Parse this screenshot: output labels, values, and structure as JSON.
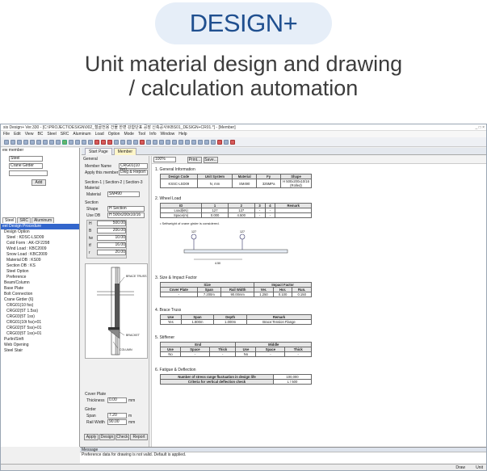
{
  "headline": {
    "badge": "DESIGN+",
    "line1": "Unit material design and drawing",
    "line2": "/ calculation automation"
  },
  "app": {
    "title": "sis Design+ Ver.330 - [C:\\PROJECT\\DESIGN\\002_철골전용 건물 한편 강합단표 공장 신축공사\\KBS01_DESIGN+CR01.*] - [Member]",
    "window_controls": "_ □ ×",
    "menus": [
      "File",
      "Edit",
      "View",
      "BC",
      "Steel",
      "SRC",
      "Aluminum",
      "Load",
      "Option",
      "Mode",
      "Tool",
      "Info",
      "Window",
      "Help"
    ]
  },
  "left": {
    "header": "ew member",
    "material_value": "Steel",
    "type_value": "Crane Girder",
    "add_label": "Add",
    "tabs": [
      "Steel",
      "SRC",
      "Aluminum"
    ],
    "tree": [
      "eel Design Procedure",
      "Design Option",
      "Steel : KDSC-LSD09",
      "Cold Form : AK-CF2298",
      "Wind Load : KBC2009",
      "Snow Load : KBC2009",
      "Material DB : KS09",
      "Section DB : KS",
      "Steel Option",
      "Preference",
      "Beam/Column",
      "Base Plate",
      "Bolt Connection",
      "Crane Girder (6)",
      "CRG01(10 fss)",
      "CRG02(5T 1.5ss)",
      "CRG03(5T 1ss)",
      "CRG01(10t fss)+01",
      "CRG02(5T 5ss)+01",
      "CRG03(5T 1ss)+01",
      "Purlin/Sinft",
      "Web Opening",
      "Steel Stair"
    ]
  },
  "doc_tabs": [
    "Start Page",
    "Member"
  ],
  "form": {
    "general": "General",
    "member_name_label": "Member Name",
    "member_name_value": "CRG01(10 fss)",
    "apply_label": "Apply this member to",
    "apply_value": "Dwg & Report",
    "section_tabs": "Section-1 | Section-2 | Section-3",
    "material_group": "Material",
    "material_label": "Material",
    "material_value": "SM490",
    "section_group": "Section",
    "shape_label": "Shape",
    "shape_value": "H Section",
    "use_db_label": "Use DB",
    "use_db_value": "H 500x200x10/16",
    "dims": [
      {
        "k": "H",
        "v": "500.00"
      },
      {
        "k": "B",
        "v": "200.00"
      },
      {
        "k": "tw",
        "v": "10.00"
      },
      {
        "k": "tf",
        "v": "16.00"
      },
      {
        "k": "r",
        "v": "20.00"
      }
    ],
    "draw_labels": {
      "brace": "BRACE TRUSS",
      "bracket": "BRACKET",
      "column": "COLUMN"
    },
    "cover_plate": "Cover Plate",
    "thickness_label": "Thickness",
    "thickness_value": "0.00",
    "thickness_unit": "mm",
    "girder": "Girder",
    "span_label": "Span",
    "span_value": "7.20",
    "span_unit": "m",
    "rail_label": "Rail Width",
    "rail_value": "90.00",
    "rail_unit": "mm",
    "buttons": [
      "Apply",
      "Design",
      "Check",
      "Report"
    ]
  },
  "report": {
    "zoom": "100%",
    "print": "Print...",
    "save": "Save...",
    "s1": "1. General Information",
    "t1h": [
      "Design Code",
      "Unit System",
      "Material",
      "Fy",
      "Shape"
    ],
    "t1r": [
      "KSSC-LSD09",
      "N, mm",
      "SM490",
      "325MPa",
      "H 500x200x10/16 (Rolled)"
    ],
    "s2": "2. Wheel Load",
    "t2h": [
      "ID",
      "1",
      "2",
      "3",
      "4",
      "Remark"
    ],
    "t2r": [
      [
        "Load(kN)",
        "127",
        "127",
        "-",
        "-",
        ""
      ],
      [
        "Space(m)",
        "0.000",
        "4.500",
        "-",
        "-",
        ""
      ]
    ],
    "note2": "• Selfweight of crane girder is considered.",
    "w1": "127",
    "w2": "127",
    "dim2": "4.50",
    "s3": "3. Size & Impact Factor",
    "t3top": [
      "Size",
      "Impact Factor"
    ],
    "t3h": [
      "Cover Plate",
      "Span",
      "Rail Width",
      "Ver.",
      "Hor.",
      "Run."
    ],
    "t3r": [
      "-",
      "7.200m",
      "90.00mm",
      "1.250",
      "0.100",
      "0.150"
    ],
    "s4": "4. Brace Truss",
    "t4h": [
      "Use",
      "Span",
      "Depth",
      "Remark"
    ],
    "t4r": [
      "Yes",
      "1.800m",
      "1.000m",
      "Brace:Tension Flange"
    ],
    "s5": "5. Stiffener",
    "t5top": [
      "End",
      "Middle"
    ],
    "t5h": [
      "Use",
      "Space",
      "Thick",
      "Use",
      "Space",
      "Thick"
    ],
    "t5r": [
      "No",
      "-",
      "-",
      "No",
      "-",
      "-"
    ],
    "s6": "6. Fatigue & Deflection",
    "t6": [
      [
        "Number of stress range fluctuation in design life",
        "100,000"
      ],
      [
        "Criteria for vertical deflection check",
        "L / 500"
      ]
    ]
  },
  "message": {
    "title": "Message",
    "text": "Preference data for drawing is not valid. Default is applied."
  },
  "status": {
    "draw": "Draw",
    "unit": "Unit"
  }
}
